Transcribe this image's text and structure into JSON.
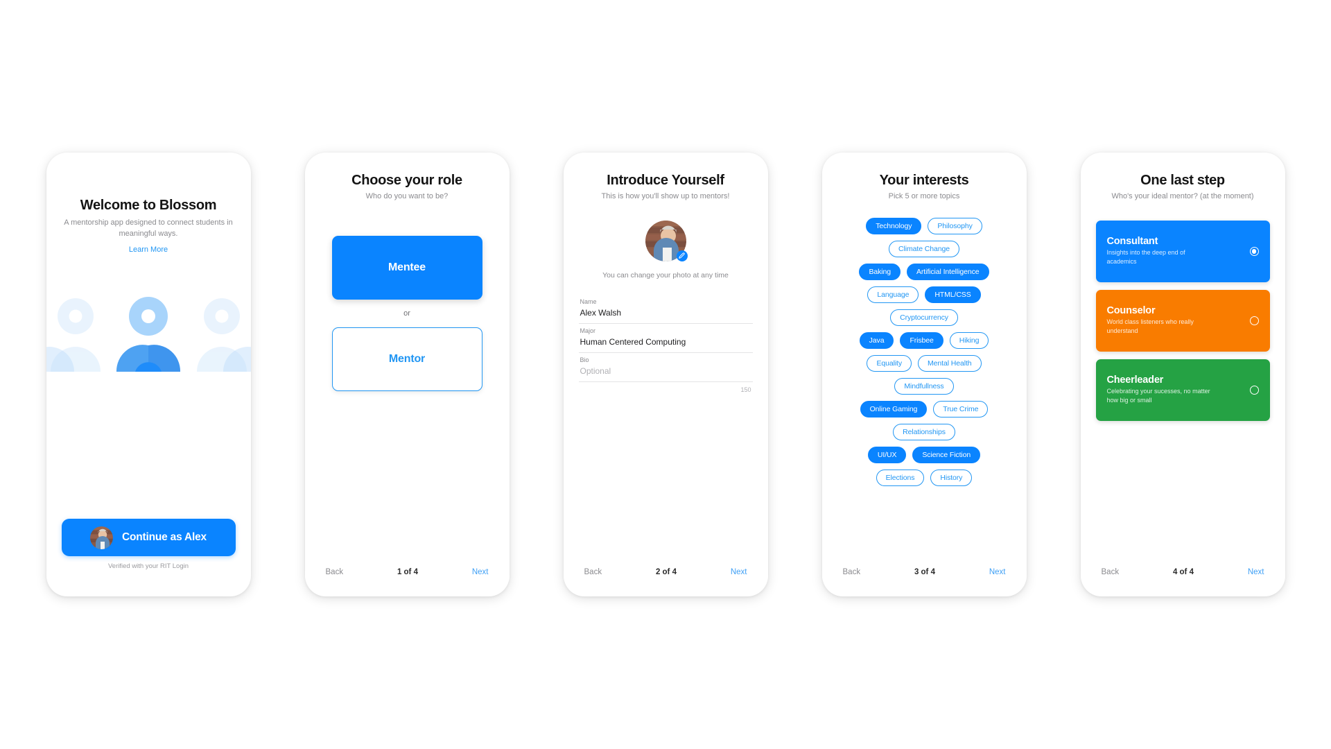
{
  "colors": {
    "accent_blue": "#0a84ff",
    "link_blue": "#2196f3",
    "orange": "#f97c00",
    "green": "#25a244",
    "muted_text": "#8a8a8e"
  },
  "screens": [
    {
      "id": "welcome",
      "title": "Welcome to Blossom",
      "subtitle": "A mentorship app designed to connect students in meaningful ways.",
      "learn_more": "Learn More",
      "continue_label": "Continue as Alex",
      "verified_note": "Verified with your RIT Login"
    },
    {
      "id": "choose-role",
      "title": "Choose your role",
      "subtitle": "Who do you want to be?",
      "primary_role": "Mentee",
      "or_label": "or",
      "secondary_role": "Mentor",
      "footer": {
        "back": "Back",
        "page": "1 of 4",
        "next": "Next"
      }
    },
    {
      "id": "introduce-yourself",
      "title": "Introduce Yourself",
      "subtitle": "This is how you'll show up to mentors!",
      "photo_note": "You can change your photo at any time",
      "fields": [
        {
          "label": "Name",
          "value": "Alex Walsh",
          "placeholder": false
        },
        {
          "label": "Major",
          "value": "Human Centered Computing",
          "placeholder": false
        },
        {
          "label": "Bio",
          "value": "Optional",
          "placeholder": true
        }
      ],
      "char_count": "150",
      "footer": {
        "back": "Back",
        "page": "2 of 4",
        "next": "Next"
      }
    },
    {
      "id": "your-interests",
      "title": "Your interests",
      "subtitle": "Pick 5 or more topics",
      "chip_rows": [
        [
          {
            "label": "Technology",
            "selected": true
          },
          {
            "label": "Philosophy",
            "selected": false
          }
        ],
        [
          {
            "label": "Climate Change",
            "selected": false
          }
        ],
        [
          {
            "label": "Baking",
            "selected": true
          },
          {
            "label": "Artificial Intelligence",
            "selected": true
          }
        ],
        [
          {
            "label": "Language",
            "selected": false
          },
          {
            "label": "HTML/CSS",
            "selected": true
          }
        ],
        [
          {
            "label": "Cryptocurrency",
            "selected": false
          }
        ],
        [
          {
            "label": "Java",
            "selected": true
          },
          {
            "label": "Frisbee",
            "selected": true
          },
          {
            "label": "Hiking",
            "selected": false
          }
        ],
        [
          {
            "label": "Equality",
            "selected": false
          },
          {
            "label": "Mental Health",
            "selected": false
          }
        ],
        [
          {
            "label": "Mindfullness",
            "selected": false
          }
        ],
        [
          {
            "label": "Online Gaming",
            "selected": true
          },
          {
            "label": "True Crime",
            "selected": false
          }
        ],
        [
          {
            "label": "Relationships",
            "selected": false
          }
        ],
        [
          {
            "label": "UI/UX",
            "selected": true
          },
          {
            "label": "Science Fiction",
            "selected": true
          }
        ],
        [
          {
            "label": "Elections",
            "selected": false
          },
          {
            "label": "History",
            "selected": false
          }
        ]
      ],
      "footer": {
        "back": "Back",
        "page": "3 of 4",
        "next": "Next"
      }
    },
    {
      "id": "one-last-step",
      "title": "One last step",
      "subtitle": "Who's your ideal mentor? (at the moment)",
      "options": [
        {
          "title": "Consultant",
          "desc": "Insights into the deep end of academics",
          "color": "#0a84ff",
          "selected": true
        },
        {
          "title": "Counselor",
          "desc": "World class listeners who really understand",
          "color": "#f97c00",
          "selected": false
        },
        {
          "title": "Cheerleader",
          "desc": "Celebrating your sucesses, no matter how big or small",
          "color": "#25a244",
          "selected": false
        }
      ],
      "footer": {
        "back": "Back",
        "page": "4 of 4",
        "next": "Next"
      }
    }
  ]
}
